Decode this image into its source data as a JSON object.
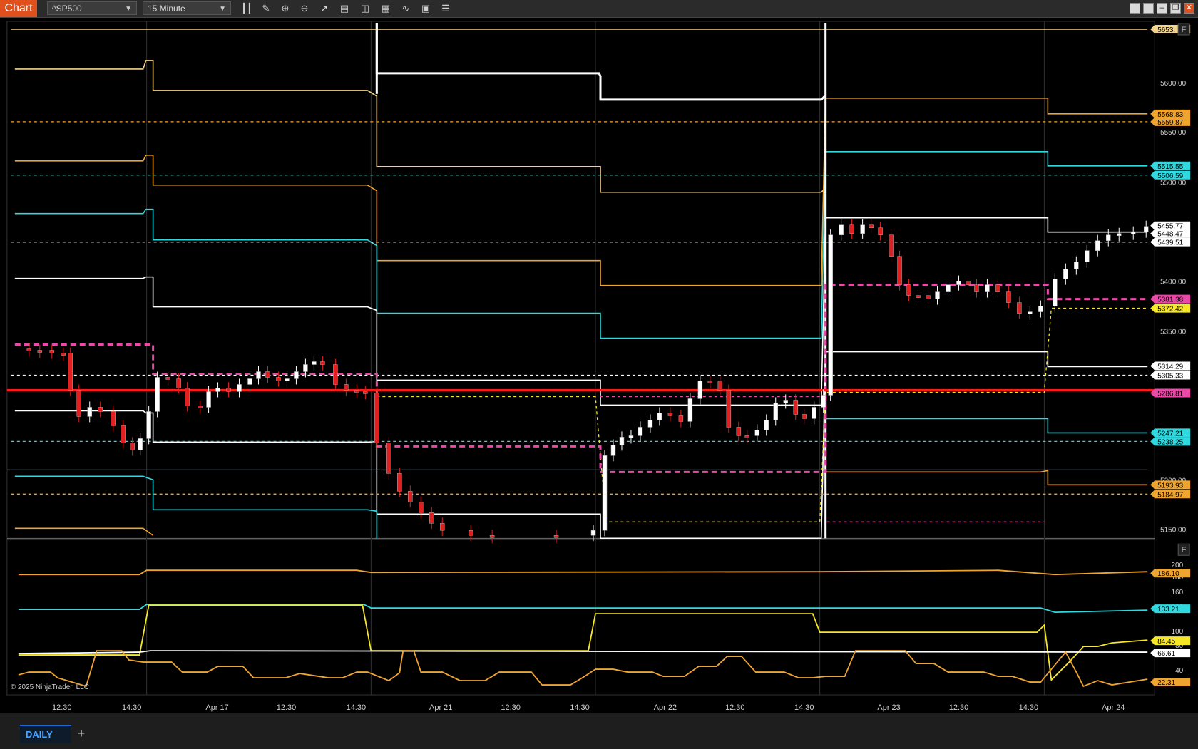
{
  "toolbar": {
    "chart_label": "Chart",
    "instrument": "^SP500",
    "interval": "15 Minute",
    "icons": [
      "bars-type-icon",
      "draw-tool-icon",
      "zoom-in-icon",
      "zoom-out-icon",
      "pointer-icon",
      "properties-icon",
      "data-box-icon",
      "strategies-icon",
      "indicators-icon",
      "templates-icon",
      "list-icon"
    ],
    "window_icons": [
      "tile-icon",
      "tile-icon",
      "minimize-icon",
      "restore-icon",
      "close-icon"
    ]
  },
  "price_axis": {
    "labels": [
      "5600.00",
      "5550.00",
      "5500.00",
      "5400.00",
      "5350.00",
      "5200.00",
      "5150.00"
    ],
    "markers": [
      {
        "text": "5653.",
        "color": "#f2d38b"
      },
      {
        "text": "5568.83",
        "color": "#f0a430"
      },
      {
        "text": "5559.87",
        "color": "#f0a430"
      },
      {
        "text": "5515.55",
        "color": "#30d9e0"
      },
      {
        "text": "5506.59",
        "color": "#30d9e0"
      },
      {
        "text": "5455.77",
        "color": "#ffffff"
      },
      {
        "text": "5448.47",
        "color": "#ffffff"
      },
      {
        "text": "5439.51",
        "color": "#ffffff"
      },
      {
        "text": "5381.38",
        "color": "#e94aa8"
      },
      {
        "text": "5372.42",
        "color": "#f5e626"
      },
      {
        "text": "5314.29",
        "color": "#ffffff"
      },
      {
        "text": "5305.33",
        "color": "#ffffff"
      },
      {
        "text": "5286.81",
        "color": "#e94aa8"
      },
      {
        "text": "5247.21",
        "color": "#30d9e0"
      },
      {
        "text": "5238.25",
        "color": "#30d9e0"
      },
      {
        "text": "5193.93",
        "color": "#f0a430"
      },
      {
        "text": "5184.97",
        "color": "#f0a430"
      }
    ]
  },
  "indicator_axis": {
    "labels": [
      "200",
      "180",
      "160",
      "140",
      "100",
      "80",
      "40",
      "20"
    ],
    "markers": [
      {
        "text": "186.10",
        "color": "#f0a430"
      },
      {
        "text": "133.21",
        "color": "#30d9e0"
      },
      {
        "text": "84.45",
        "color": "#f5e626"
      },
      {
        "text": "66.61",
        "color": "#ffffff"
      },
      {
        "text": "22.31",
        "color": "#f0a430"
      }
    ]
  },
  "time_axis": {
    "labels": [
      "12:30",
      "14:30",
      "Apr 17",
      "12:30",
      "14:30",
      "Apr 21",
      "12:30",
      "14:30",
      "Apr 22",
      "12:30",
      "14:30",
      "Apr 23",
      "12:30",
      "14:30",
      "Apr 24"
    ]
  },
  "copyright": "© 2025 NinjaTrader, LLC",
  "panel_button": "F",
  "tabs": [
    {
      "label": "DAILY"
    }
  ],
  "add_tab": "+"
}
